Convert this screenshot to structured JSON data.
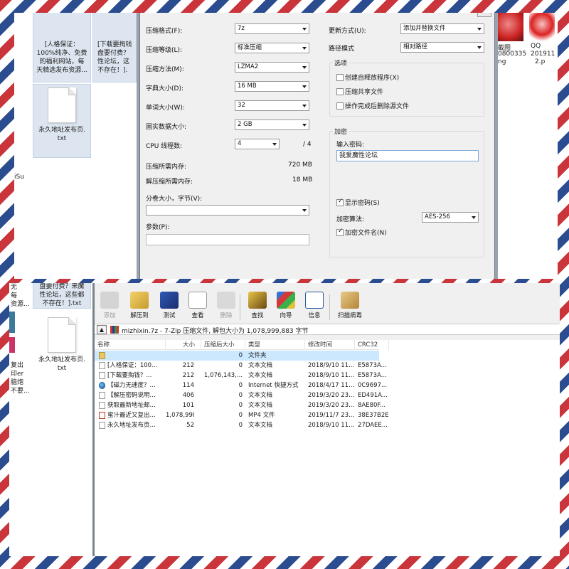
{
  "top_desktop": {
    "items": [
      {
        "lines": [
          "[人格保证：",
          "100%纯净、免费",
          "的福利网站，每",
          "天精选发布资源..."
        ]
      },
      {
        "lines": [
          "[下载要掏钱",
          "盘要付费？",
          "性论坛，这",
          "不存在！]."
        ]
      },
      {
        "lines": [
          "永久地址发布页.",
          "txt"
        ]
      }
    ],
    "edge_label": "iSu",
    "right_labels": {
      "pic1": "截图",
      "pic2": "QQ",
      "num1": "0800335",
      "num2": "201911",
      "suffix1": "ng",
      "suffix2": "2.p"
    }
  },
  "dialog": {
    "left": {
      "format_label": "压缩格式(F):",
      "format_value": "7z",
      "level_label": "压缩等级(L):",
      "level_value": "标准压缩",
      "method_label": "压缩方法(M):",
      "method_value": "LZMA2",
      "dict_label": "字典大小(D):",
      "dict_value": "16 MB",
      "word_label": "单词大小(W):",
      "word_value": "32",
      "solid_label": "固实数据大小:",
      "solid_value": "2 GB",
      "cpu_label": "CPU 线程数:",
      "cpu_value": "4",
      "cpu_total": "/ 4",
      "mem_comp_label": "压缩所需内存:",
      "mem_comp_value": "720 MB",
      "mem_decomp_label": "解压缩所需内存:",
      "mem_decomp_value": "18 MB",
      "volume_label": "分卷大小，字节(V):",
      "params_label": "参数(P):"
    },
    "right": {
      "update_label": "更新方式(U):",
      "update_value": "添加并替换文件",
      "path_label": "路径模式",
      "path_value": "相对路径",
      "options_title": "选项",
      "opt_sfx": "创建自释放程序(X)",
      "opt_shared": "压缩共享文件",
      "opt_delete": "操作完成后删除源文件",
      "encrypt_title": "加密",
      "password_label": "输入密码:",
      "password_value": "我爱魔性论坛",
      "show_password": "显示密码(S)",
      "enc_method_label": "加密算法:",
      "enc_method_value": "AES-256",
      "enc_names": "加密文件名(N)"
    }
  },
  "bottom_desktop": {
    "items": [
      {
        "lines": [
          "盘要付费？来魔",
          "性论坛，这些都",
          "不存在！].txt"
        ]
      },
      {
        "lines": [
          "永久地址发布页.",
          "txt"
        ]
      }
    ],
    "edge_lines": [
      "无",
      "每",
      "资源...",
      "复出",
      "印er",
      "脑炮",
      "不要..."
    ]
  },
  "filemanager": {
    "toolbar": [
      {
        "label": "添加",
        "icon": "add-icon",
        "disabled": true
      },
      {
        "label": "解压到",
        "icon": "extract-icon",
        "disabled": false
      },
      {
        "label": "测试",
        "icon": "test-icon",
        "disabled": false
      },
      {
        "label": "查看",
        "icon": "view-icon",
        "disabled": false
      },
      {
        "label": "删除",
        "icon": "delete-icon",
        "disabled": true
      },
      {
        "label": "查找",
        "icon": "find-icon",
        "disabled": false
      },
      {
        "label": "向导",
        "icon": "wizard-icon",
        "disabled": false
      },
      {
        "label": "信息",
        "icon": "info-icon",
        "disabled": false
      },
      {
        "label": "扫描病毒",
        "icon": "virus-scan-icon",
        "disabled": false
      }
    ],
    "address": "mizhixin.7z - 7-Zip 压缩文件, 解包大小为 1,078,999,883 字节",
    "columns": [
      "名称",
      "大小",
      "压缩后大小",
      "类型",
      "修改时间",
      "CRC32"
    ],
    "rows": [
      {
        "name": "",
        "size": "",
        "packed": "0",
        "type": "文件夹",
        "modified": "",
        "crc": "",
        "icon": "folder",
        "selected": true
      },
      {
        "name": "[人格保证：100...",
        "size": "212",
        "packed": "0",
        "type": "文本文档",
        "modified": "2018/9/10 11...",
        "crc": "E5873A...",
        "icon": "txt",
        "selected": false
      },
      {
        "name": "[下载要掏钱？...",
        "size": "212",
        "packed": "1,076,143,...",
        "type": "文本文档",
        "modified": "2018/9/10 11...",
        "crc": "E5873A...",
        "icon": "txt",
        "selected": false
      },
      {
        "name": "【磁力无速度？...",
        "size": "114",
        "packed": "0",
        "type": "Internet 快捷方式",
        "modified": "2018/4/17 11...",
        "crc": "0C9697...",
        "icon": "globe",
        "selected": false
      },
      {
        "name": "【解压密码说明...",
        "size": "406",
        "packed": "0",
        "type": "文本文档",
        "modified": "2019/3/20 23...",
        "crc": "ED491A...",
        "icon": "txt",
        "selected": false
      },
      {
        "name": "获取最新地址邮...",
        "size": "101",
        "packed": "0",
        "type": "文本文档",
        "modified": "2019/3/20 23...",
        "crc": "8AE80F...",
        "icon": "txt",
        "selected": false
      },
      {
        "name": "蜜汁最近又复出...",
        "size": "1,078,998,...",
        "packed": "0",
        "type": "MP4 文件",
        "modified": "2019/11/7 23...",
        "crc": "38E37B2E",
        "icon": "mp4",
        "selected": false
      },
      {
        "name": "永久地址发布页...",
        "size": "52",
        "packed": "0",
        "type": "文本文档",
        "modified": "2018/9/10 11...",
        "crc": "27DAEE...",
        "icon": "txt",
        "selected": false
      }
    ]
  },
  "colors": {
    "stripe_red": "#c9353a",
    "stripe_blue": "#2b4d8f",
    "selection": "#cce8ff"
  }
}
